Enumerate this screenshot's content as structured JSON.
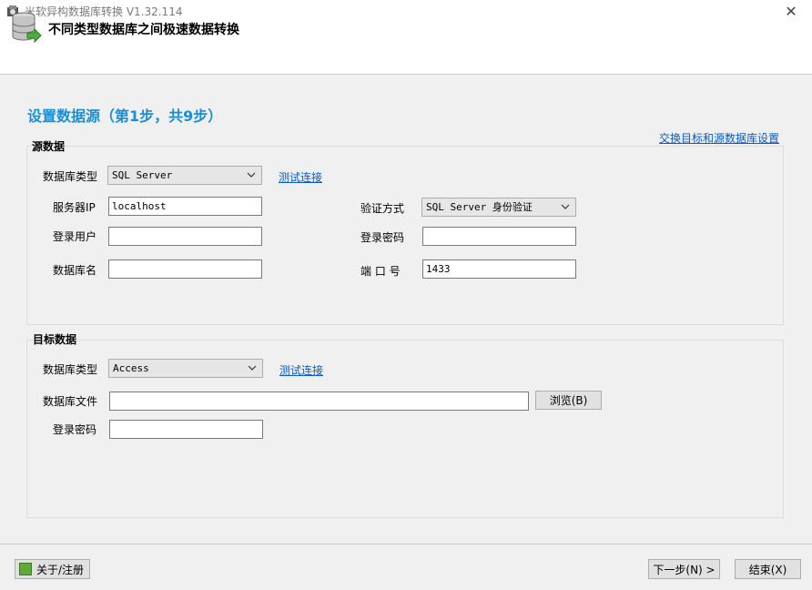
{
  "window": {
    "title": "米软异构数据库转换 V1.32.114",
    "close_label": "✕"
  },
  "header": {
    "title": "不同类型数据库之间极速数据转换"
  },
  "step": {
    "title": "设置数据源（第1步，共9步）",
    "swap_link": "交换目标和源数据库设置"
  },
  "source": {
    "group_title": "源数据",
    "db_type_label": "数据库类型",
    "db_type_value": "SQL Server",
    "test_link": "测试连接",
    "server_ip_label": "服务器IP",
    "server_ip_value": "localhost",
    "auth_label": "验证方式",
    "auth_value": "SQL Server 身份验证",
    "user_label": "登录用户",
    "user_value": "",
    "password_label": "登录密码",
    "password_value": "",
    "db_name_label": "数据库名",
    "db_name_value": "",
    "port_label": "端 口 号",
    "port_value": "1433"
  },
  "target": {
    "group_title": "目标数据",
    "db_type_label": "数据库类型",
    "db_type_value": "Access",
    "test_link": "测试连接",
    "db_file_label": "数据库文件",
    "db_file_value": "",
    "browse_label": "浏览(B)",
    "password_label": "登录密码",
    "password_value": ""
  },
  "footer": {
    "about_label": "关于/注册",
    "next_label": "下一步(N) >",
    "finish_label": "结束(X)"
  },
  "colors": {
    "accent": "#1a8fd8",
    "link": "#0a5bc4",
    "background": "#f0f0f0"
  },
  "icons": {
    "app": "app-icon",
    "database": "database-arrow-icon",
    "dropdown": "chevron-down-icon",
    "about": "about-icon",
    "close": "close-icon"
  }
}
